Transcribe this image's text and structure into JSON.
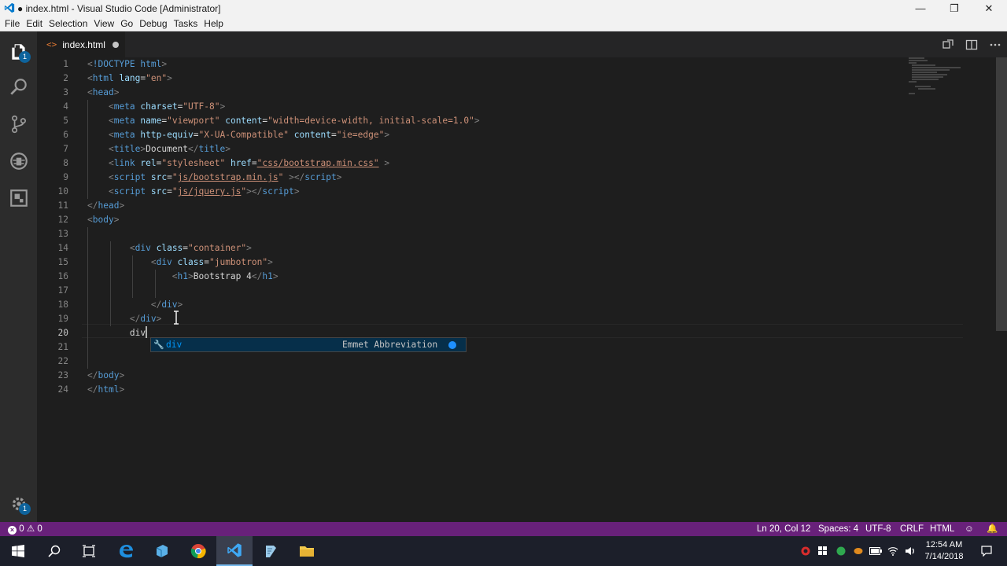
{
  "window": {
    "title": "● index.html - Visual Studio Code [Administrator]",
    "minimize_glyph": "—",
    "restore_glyph": "❐",
    "close_glyph": "✕"
  },
  "menu": [
    "File",
    "Edit",
    "Selection",
    "View",
    "Go",
    "Debug",
    "Tasks",
    "Help"
  ],
  "activity": {
    "explorer_badge": "1",
    "settings_badge": "1",
    "icons": [
      "files-icon",
      "search-icon",
      "source-control-icon",
      "debug-icon",
      "extensions-icon",
      "settings-gear-icon"
    ]
  },
  "tab": {
    "filename": "index.html",
    "icon_glyph": "<>"
  },
  "editor": {
    "lines": [
      {
        "n": "1"
      },
      {
        "n": "2"
      },
      {
        "n": "3"
      },
      {
        "n": "4"
      },
      {
        "n": "5"
      },
      {
        "n": "6"
      },
      {
        "n": "7"
      },
      {
        "n": "8"
      },
      {
        "n": "9"
      },
      {
        "n": "10"
      },
      {
        "n": "11"
      },
      {
        "n": "12"
      },
      {
        "n": "13"
      },
      {
        "n": "14"
      },
      {
        "n": "15"
      },
      {
        "n": "16"
      },
      {
        "n": "17"
      },
      {
        "n": "18"
      },
      {
        "n": "19"
      },
      {
        "n": "20"
      },
      {
        "n": "21"
      },
      {
        "n": "22"
      },
      {
        "n": "23"
      },
      {
        "n": "24"
      }
    ],
    "text": {
      "doctype": "!DOCTYPE html",
      "html": "html",
      "lang": "lang",
      "en": "\"en\"",
      "head": "head",
      "meta": "meta",
      "charset": "charset",
      "utf8": "\"UTF-8\"",
      "name": "name",
      "viewport": "\"viewport\"",
      "content": "content",
      "viewport_content": "\"width=device-width, initial-scale=1.0\"",
      "http_equiv": "http-equiv",
      "xua": "\"X-UA-Compatible\"",
      "ie_edge": "\"ie=edge\"",
      "title": "title",
      "document": "Document",
      "link": "link",
      "rel": "rel",
      "stylesheet": "\"stylesheet\"",
      "href": "href",
      "css_href": "\"css/bootstrap.min.css\"",
      "script": "script",
      "src": "src",
      "js1_q": "\"",
      "js1": "js/bootstrap.min.js",
      "js2": "js/jquery.js",
      "body": "body",
      "div": "div",
      "class": "class",
      "container": "\"container\"",
      "jumbotron": "\"jumbotron\"",
      "h1": "h1",
      "h1_text": "Bootstrap 4",
      "typed": "div"
    }
  },
  "suggest": {
    "label": "div",
    "detail": "Emmet Abbreviation"
  },
  "status": {
    "errors": "0",
    "warnings": "0",
    "position": "Ln 20, Col 12",
    "spaces": "Spaces: 4",
    "encoding": "UTF-8",
    "eol": "CRLF",
    "language": "HTML"
  },
  "taskbar": {
    "time": "12:54 AM",
    "date": "7/14/2018",
    "apps": [
      "start-button",
      "search-button",
      "task-view-button",
      "edge-icon",
      "file-icon",
      "chrome-icon",
      "vscode-icon",
      "notepad-icon",
      "file-explorer-icon"
    ]
  }
}
